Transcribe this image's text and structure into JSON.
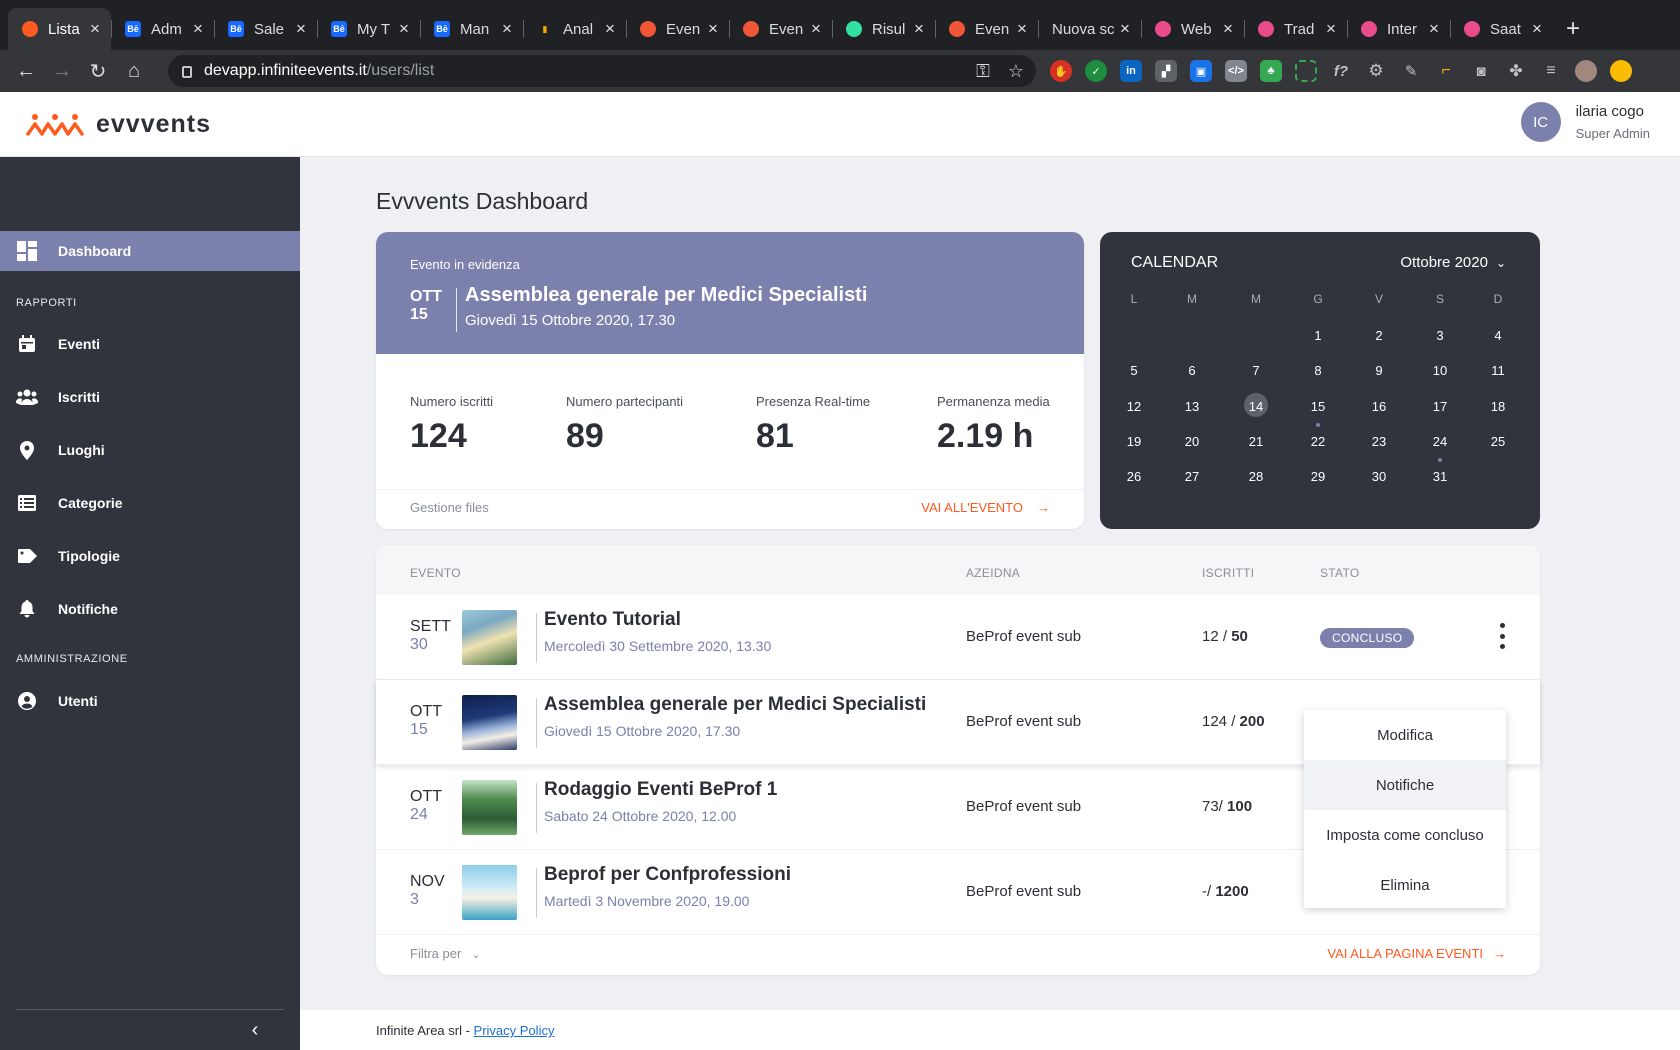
{
  "browser": {
    "tabs": [
      {
        "title": "Lista",
        "icon": "evvvents-icon",
        "color": "#ff5a1f",
        "active": true
      },
      {
        "title": "Adm",
        "icon": "behance-icon",
        "color": "#1769ff"
      },
      {
        "title": "Sale",
        "icon": "behance-icon",
        "color": "#1769ff"
      },
      {
        "title": "My T",
        "icon": "behance-icon",
        "color": "#1769ff"
      },
      {
        "title": "Man",
        "icon": "behance-icon",
        "color": "#1769ff"
      },
      {
        "title": "Anal",
        "icon": "analytics-icon",
        "color": "#f9ab00"
      },
      {
        "title": "Even",
        "icon": "eventbrite-icon",
        "color": "#f05537"
      },
      {
        "title": "Even",
        "icon": "eventbrite-icon",
        "color": "#f05537"
      },
      {
        "title": "Risul",
        "icon": "tripadvisor-icon",
        "color": "#34e0a1"
      },
      {
        "title": "Even",
        "icon": "eventbrite-icon",
        "color": "#f05537"
      },
      {
        "title": "Nuova sc",
        "icon": "",
        "color": ""
      },
      {
        "title": "Web",
        "icon": "dribbble-icon",
        "color": "#ea4c89"
      },
      {
        "title": "Trad",
        "icon": "dribbble-icon",
        "color": "#ea4c89"
      },
      {
        "title": "Inter",
        "icon": "dribbble-icon",
        "color": "#ea4c89"
      },
      {
        "title": "Saat",
        "icon": "dribbble-icon",
        "color": "#ea4c89"
      }
    ],
    "url_host": "devapp.infiniteevents.it",
    "url_path": "/users/list"
  },
  "header": {
    "brand": "evvvents",
    "user_initials": "IC",
    "user_name": "ilaria cogo",
    "user_role": "Super Admin"
  },
  "sidebar": {
    "dashboard": "Dashboard",
    "section_reports": "RAPPORTI",
    "items": [
      "Eventi",
      "Iscritti",
      "Luoghi",
      "Categorie",
      "Tipologie",
      "Notifiche"
    ],
    "section_admin": "AMMINISTRAZIONE",
    "admin_items": [
      "Utenti"
    ]
  },
  "page": {
    "title": "Evvvents Dashboard"
  },
  "featured": {
    "eyebrow": "Evento in evidenza",
    "month": "OTT",
    "day": "15",
    "title": "Assemblea generale per Medici Specialisti",
    "subtitle": "Giovedì 15 Ottobre 2020, 17.30",
    "stats": [
      {
        "label": "Numero iscritti",
        "value": "124"
      },
      {
        "label": "Numero partecipanti",
        "value": "89"
      },
      {
        "label": "Presenza Real-time",
        "value": "81"
      },
      {
        "label": "Permanenza media",
        "value": "2.19 h"
      }
    ],
    "files_label": "Gestione files",
    "go_label": "VAI ALL'EVENTO"
  },
  "calendar": {
    "title": "CALENDAR",
    "month": "Ottobre 2020",
    "weekdays": [
      "L",
      "M",
      "M",
      "G",
      "V",
      "S",
      "D"
    ],
    "start_weekday_index": 3,
    "days_in_month": 31,
    "today": 14,
    "event_days": [
      15,
      24
    ]
  },
  "events": {
    "columns": [
      "EVENTO",
      "AZEIDNA",
      "ISCRITTI",
      "STATO"
    ],
    "rows": [
      {
        "month": "SETT",
        "day": "30",
        "title": "Evento Tutorial",
        "subtitle": "Mercoledì 30 Settembre 2020, 13.30",
        "company": "BeProf event sub",
        "enrolled": "12 / ",
        "capacity": "50",
        "status": "CONCLUSO"
      },
      {
        "month": "OTT",
        "day": "15",
        "title": "Assemblea generale per Medici Specialisti",
        "subtitle": "Giovedì 15 Ottobre 2020, 17.30",
        "company": "BeProf event sub",
        "enrolled": "124 / ",
        "capacity": "200",
        "status": ""
      },
      {
        "month": "OTT",
        "day": "24",
        "title": "Rodaggio Eventi BeProf 1",
        "subtitle": "Sabato 24 Ottobre 2020, 12.00",
        "company": "BeProf event sub",
        "enrolled": "73/ ",
        "capacity": "100",
        "status": ""
      },
      {
        "month": "NOV",
        "day": "3",
        "title": "Beprof per Confprofessioni",
        "subtitle": "Martedì 3 Novembre 2020, 19.00",
        "company": "BeProf event sub",
        "enrolled": "-/ ",
        "capacity": "1200",
        "status": ""
      }
    ],
    "filter_label": "Filtra per",
    "go_label": "VAI ALLA PAGINA EVENTI"
  },
  "menu": {
    "items": [
      "Modifica",
      "Notifiche",
      "Imposta come concluso",
      "Elimina"
    ]
  },
  "footer": {
    "company": "Infinite Area srl - ",
    "privacy": "Privacy Policy"
  },
  "colors": {
    "accent": "#7b80ad",
    "brand": "#ff5a1f",
    "sidebar": "#31343d"
  }
}
